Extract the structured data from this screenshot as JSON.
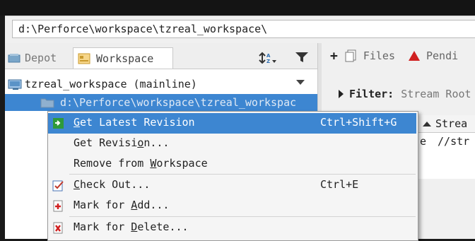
{
  "path_bar": {
    "value": "d:\\Perforce\\workspace\\tzreal_workspace\\"
  },
  "left_panel": {
    "tabs": [
      {
        "label": "Depot"
      },
      {
        "label": "Workspace"
      }
    ],
    "tree": {
      "root_label": "tzreal_workspace (mainline)",
      "selected_path": "d:\\Perforce\\workspace\\tzreal_workspac"
    }
  },
  "right_panel": {
    "files_label": "Files",
    "pending_label": "Pendi",
    "filter_label": "Filter:",
    "filter_value": "Stream Root",
    "column_header": "Strea",
    "row_prefix": "e",
    "row_value": "//str"
  },
  "context_menu": {
    "items": [
      {
        "mnemonic": "G",
        "rest": "et Latest Revision",
        "shortcut": "Ctrl+Shift+G",
        "icon": "get-latest-icon",
        "highlighted": true
      },
      {
        "before": "Get Revisi",
        "mnemonic": "o",
        "rest": "n...",
        "shortcut": "",
        "icon": ""
      },
      {
        "before": "Remove from ",
        "mnemonic": "W",
        "rest": "orkspace",
        "shortcut": "",
        "icon": ""
      },
      {
        "mnemonic": "C",
        "rest": "heck Out...",
        "shortcut": "Ctrl+E",
        "icon": "checkout-icon"
      },
      {
        "before": "Mark for ",
        "mnemonic": "A",
        "rest": "dd...",
        "shortcut": "",
        "icon": "mark-add-icon"
      },
      {
        "before": "Mark for ",
        "mnemonic": "D",
        "rest": "elete...",
        "shortcut": "",
        "icon": "mark-delete-icon"
      }
    ]
  },
  "colors": {
    "selection": "#3d86d1",
    "pending_icon": "#d02020",
    "accent_green": "#2e9a3a"
  }
}
